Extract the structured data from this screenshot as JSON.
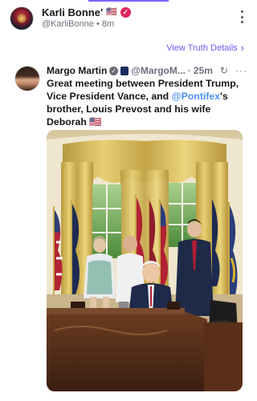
{
  "post": {
    "author_name": "Karli Bonne'",
    "author_flag": "🇺🇸",
    "author_handle": "@KarliBonne",
    "separator": "•",
    "time_ago": "8m",
    "view_link_label": "View Truth Details",
    "view_link_chevron": ">"
  },
  "quoted": {
    "author_name": "Margo Martin",
    "author_handle": "@MargoM...",
    "separator": "·",
    "time_ago": "25m",
    "more_label": "···",
    "text_part1": "Great meeting between President Trump, Vice President Vance, and ",
    "mention": "@Pontifex",
    "text_part2": "'s brother, Louis Prevost and his wife Deborah ",
    "text_flag": "🇺🇸"
  },
  "colors": {
    "accent_purple": "#6a5cf0",
    "verified_pink": "#e0245e",
    "mention_blue": "#4a8ef0",
    "text_gray": "#6e6e80"
  },
  "icons": {
    "verified": "verified-badge-icon",
    "more": "vertical-ellipsis-icon",
    "refresh": "repost-icon",
    "chevron": "chevron-right-icon"
  }
}
